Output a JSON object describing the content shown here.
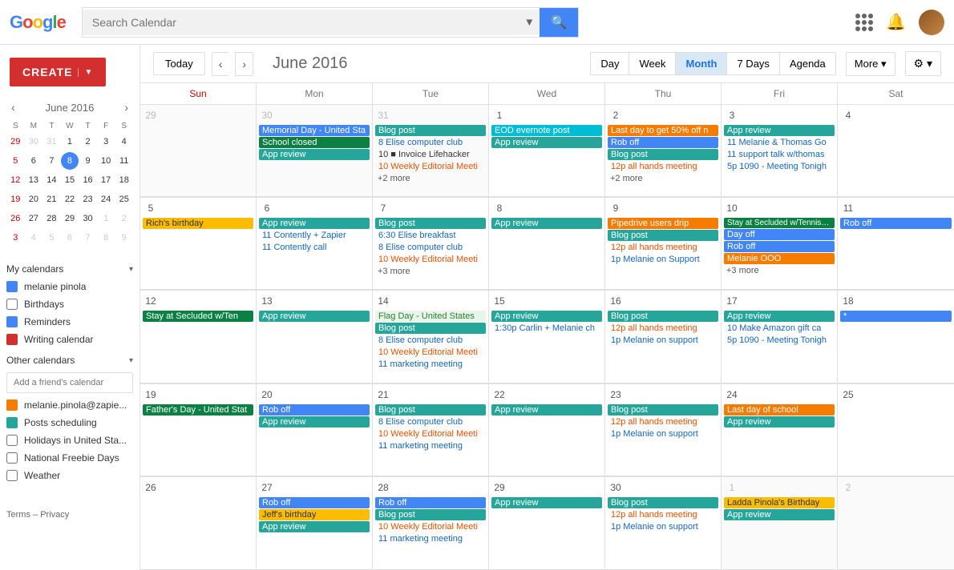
{
  "header": {
    "logo_text": "Google",
    "search_placeholder": "Search Calendar",
    "search_value": ""
  },
  "toolbar": {
    "today_label": "Today",
    "title": "June 2016",
    "views": [
      "Day",
      "Week",
      "Month",
      "7 Days",
      "Agenda"
    ],
    "active_view": "Month",
    "more_label": "More",
    "settings_label": "⚙"
  },
  "sidebar": {
    "create_label": "CREATE",
    "mini_cal": {
      "title": "June 2016",
      "dows": [
        "S",
        "M",
        "T",
        "W",
        "T",
        "F",
        "S"
      ],
      "weeks": [
        [
          {
            "d": "29",
            "other": true,
            "sun": true
          },
          {
            "d": "30",
            "other": true
          },
          {
            "d": "31",
            "other": true
          },
          {
            "d": "1",
            "sun": false
          },
          {
            "d": "2"
          },
          {
            "d": "3"
          },
          {
            "d": "4",
            "sat": true
          }
        ],
        [
          {
            "d": "5",
            "sun": true
          },
          {
            "d": "6"
          },
          {
            "d": "7"
          },
          {
            "d": "8",
            "today": true
          },
          {
            "d": "9"
          },
          {
            "d": "10"
          },
          {
            "d": "11",
            "sat": true
          }
        ],
        [
          {
            "d": "12",
            "sun": true
          },
          {
            "d": "13"
          },
          {
            "d": "14"
          },
          {
            "d": "15"
          },
          {
            "d": "16"
          },
          {
            "d": "17"
          },
          {
            "d": "18",
            "sat": true
          }
        ],
        [
          {
            "d": "19",
            "sun": true
          },
          {
            "d": "20"
          },
          {
            "d": "21"
          },
          {
            "d": "22"
          },
          {
            "d": "23"
          },
          {
            "d": "24"
          },
          {
            "d": "25",
            "sat": true
          }
        ],
        [
          {
            "d": "26",
            "sun": true
          },
          {
            "d": "27"
          },
          {
            "d": "28"
          },
          {
            "d": "29"
          },
          {
            "d": "30"
          },
          {
            "d": "1",
            "other": true
          },
          {
            "d": "2",
            "other": true,
            "sat": true
          }
        ],
        [
          {
            "d": "3",
            "other": true,
            "sun": true
          },
          {
            "d": "4",
            "other": true
          },
          {
            "d": "5",
            "other": true
          },
          {
            "d": "6",
            "other": true
          },
          {
            "d": "7",
            "other": true
          },
          {
            "d": "8",
            "other": true
          },
          {
            "d": "9",
            "other": true,
            "sat": true
          }
        ]
      ]
    },
    "my_calendars": {
      "title": "My calendars",
      "items": [
        {
          "label": "melanie pinola",
          "color": "#4285F4",
          "checked": true
        },
        {
          "label": "Birthdays",
          "color": null,
          "checked": false
        },
        {
          "label": "Reminders",
          "color": "#4285F4",
          "checked": true
        },
        {
          "label": "Writing calendar",
          "color": "#D32F2F",
          "checked": true
        }
      ]
    },
    "other_calendars": {
      "title": "Other calendars",
      "add_placeholder": "Add a friend's calendar",
      "items": [
        {
          "label": "melanie.pinola@zapie...",
          "color": "#F57C00",
          "checked": true
        },
        {
          "label": "Posts scheduling",
          "color": "#26A69A",
          "checked": true
        },
        {
          "label": "Holidays in United Sta...",
          "color": null,
          "checked": false
        },
        {
          "label": "National Freebie Days",
          "color": null,
          "checked": false
        },
        {
          "label": "Weather",
          "color": null,
          "checked": false
        }
      ]
    },
    "footer": {
      "terms": "Terms",
      "privacy": "Privacy"
    }
  },
  "calendar": {
    "day_headers": [
      "Sun",
      "Mon",
      "Tue",
      "Wed",
      "Thu",
      "Fri",
      "Sat"
    ],
    "weeks": [
      {
        "cells": [
          {
            "day": "29",
            "other": true,
            "events": []
          },
          {
            "day": "30",
            "other": true,
            "events": [
              {
                "text": "Memorial Day - United Sta",
                "cls": "allday-blue"
              },
              {
                "text": "School closed",
                "cls": "allday-green"
              },
              {
                "text": "App review",
                "cls": "teal"
              }
            ]
          },
          {
            "day": "31",
            "other": true,
            "events": [
              {
                "text": "Blog post",
                "cls": "teal"
              },
              {
                "text": "8 Elise computer club",
                "cls": "text-blue"
              },
              {
                "text": "10 ■ Invoice Lifehacker",
                "cls": "text-only"
              },
              {
                "text": "10 Weekly Editorial Meeti",
                "cls": "text-orange"
              },
              {
                "text": "+2 more",
                "cls": "more-link"
              }
            ]
          },
          {
            "day": "1",
            "events": [
              {
                "text": "EOD evernote post",
                "cls": "cyan"
              },
              {
                "text": "App review",
                "cls": "teal"
              }
            ]
          },
          {
            "day": "2",
            "events": [
              {
                "text": "Last day to get 50% off n",
                "cls": "orange"
              },
              {
                "text": "Rob off",
                "cls": "allday-blue"
              },
              {
                "text": "Blog post",
                "cls": "teal"
              },
              {
                "text": "12p all hands meeting",
                "cls": "text-orange"
              },
              {
                "text": "+2 more",
                "cls": "more-link"
              }
            ]
          },
          {
            "day": "3",
            "events": [
              {
                "text": "App review",
                "cls": "teal"
              },
              {
                "text": "11 Melanie & Thomas Go",
                "cls": "text-blue"
              },
              {
                "text": "11 support talk w/thomas",
                "cls": "text-blue"
              },
              {
                "text": "5p 1090 - Meeting Tonigh",
                "cls": "text-blue"
              }
            ]
          },
          {
            "day": "4",
            "other": false,
            "events": []
          }
        ]
      },
      {
        "cells": [
          {
            "day": "5",
            "events": [
              {
                "text": "Rich's birthday",
                "cls": "bday"
              }
            ]
          },
          {
            "day": "6",
            "events": [
              {
                "text": "App review",
                "cls": "teal"
              },
              {
                "text": "11 Contently + Zapier",
                "cls": "text-blue"
              },
              {
                "text": "11 Contently call",
                "cls": "text-blue"
              }
            ]
          },
          {
            "day": "7",
            "events": [
              {
                "text": "Blog post",
                "cls": "teal"
              },
              {
                "text": "6:30 Elise breakfast",
                "cls": "text-blue"
              },
              {
                "text": "8 Elise computer club",
                "cls": "text-blue"
              },
              {
                "text": "10 Weekly Editorial Meeti",
                "cls": "text-orange"
              },
              {
                "text": "+3 more",
                "cls": "more-link"
              }
            ]
          },
          {
            "day": "8",
            "events": [
              {
                "text": "App review",
                "cls": "teal"
              }
            ]
          },
          {
            "day": "9",
            "events": [
              {
                "text": "Pipedrive users drip",
                "cls": "orange"
              },
              {
                "text": "Blog post",
                "cls": "teal"
              },
              {
                "text": "12p all hands meeting",
                "cls": "text-orange"
              },
              {
                "text": "1p Melanie on Support",
                "cls": "text-blue"
              }
            ]
          },
          {
            "day": "10",
            "events": [
              {
                "text": "Stay at Secluded w/Tennis/Koi Pond/Hot Tub - Secl",
                "cls": "allday-green"
              },
              {
                "text": "Day off",
                "cls": "allday-blue"
              },
              {
                "text": "Rob off",
                "cls": "allday-blue"
              },
              {
                "text": "Melanie OOO",
                "cls": "orange"
              },
              {
                "text": "+3 more",
                "cls": "more-link"
              }
            ]
          },
          {
            "day": "11",
            "events": [
              {
                "text": "Rob off",
                "cls": "allday-blue"
              }
            ]
          }
        ]
      },
      {
        "cells": [
          {
            "day": "12",
            "events": [
              {
                "text": "Stay at Secluded w/Ten",
                "cls": "allday-green"
              }
            ]
          },
          {
            "day": "13",
            "events": [
              {
                "text": "App review",
                "cls": "teal"
              }
            ]
          },
          {
            "day": "14",
            "events": [
              {
                "text": "Flag Day - United States",
                "cls": "holiday"
              },
              {
                "text": "Blog post",
                "cls": "teal"
              },
              {
                "text": "8 Elise computer club",
                "cls": "text-blue"
              },
              {
                "text": "10 Weekly Editorial Meeti",
                "cls": "text-orange"
              },
              {
                "text": "11 marketing meeting",
                "cls": "text-blue"
              }
            ]
          },
          {
            "day": "15",
            "events": [
              {
                "text": "App review",
                "cls": "teal"
              },
              {
                "text": "1:30p Carlin + Melanie ch",
                "cls": "text-blue"
              }
            ]
          },
          {
            "day": "16",
            "events": [
              {
                "text": "Blog post",
                "cls": "teal"
              },
              {
                "text": "12p all hands meeting",
                "cls": "text-orange"
              },
              {
                "text": "1p Melanie on support",
                "cls": "text-blue"
              }
            ]
          },
          {
            "day": "17",
            "events": [
              {
                "text": "App review",
                "cls": "teal"
              },
              {
                "text": "10 Make Amazon gift ca",
                "cls": "text-blue"
              },
              {
                "text": "5p 1090 - Meeting Tonigh",
                "cls": "text-blue"
              }
            ]
          },
          {
            "day": "18",
            "events": [
              {
                "text": "*",
                "cls": "blue"
              }
            ]
          }
        ]
      },
      {
        "cells": [
          {
            "day": "19",
            "events": [
              {
                "text": "Father's Day - United Stat",
                "cls": "allday-green"
              }
            ]
          },
          {
            "day": "20",
            "events": [
              {
                "text": "Rob off",
                "cls": "allday-blue"
              },
              {
                "text": "App review",
                "cls": "teal"
              }
            ]
          },
          {
            "day": "21",
            "events": [
              {
                "text": "Blog post",
                "cls": "teal"
              },
              {
                "text": "8 Elise computer club",
                "cls": "text-blue"
              },
              {
                "text": "10 Weekly Editorial Meeti",
                "cls": "text-orange"
              },
              {
                "text": "11 marketing meeting",
                "cls": "text-blue"
              }
            ]
          },
          {
            "day": "22",
            "events": [
              {
                "text": "App review",
                "cls": "teal"
              }
            ]
          },
          {
            "day": "23",
            "events": [
              {
                "text": "Blog post",
                "cls": "teal"
              },
              {
                "text": "12p all hands meeting",
                "cls": "text-orange"
              },
              {
                "text": "1p Melanie on support",
                "cls": "text-blue"
              }
            ]
          },
          {
            "day": "24",
            "events": [
              {
                "text": "Last day of school",
                "cls": "orange"
              },
              {
                "text": "App review",
                "cls": "teal"
              }
            ]
          },
          {
            "day": "25",
            "events": []
          }
        ]
      },
      {
        "cells": [
          {
            "day": "26",
            "events": []
          },
          {
            "day": "27",
            "events": [
              {
                "text": "Rob off",
                "cls": "allday-blue"
              },
              {
                "text": "Jeff's birthday",
                "cls": "bday"
              },
              {
                "text": "App review",
                "cls": "teal"
              }
            ]
          },
          {
            "day": "28",
            "events": [
              {
                "text": "Rob off",
                "cls": "allday-blue"
              },
              {
                "text": "Blog post",
                "cls": "teal"
              },
              {
                "text": "10 Weekly Editorial Meeti",
                "cls": "text-orange"
              },
              {
                "text": "11 marketing meeting",
                "cls": "text-blue"
              }
            ]
          },
          {
            "day": "29",
            "events": [
              {
                "text": "App review",
                "cls": "teal"
              }
            ]
          },
          {
            "day": "30",
            "events": [
              {
                "text": "Blog post",
                "cls": "teal"
              },
              {
                "text": "12p all hands meeting",
                "cls": "text-orange"
              },
              {
                "text": "1p Melanie on support",
                "cls": "text-blue"
              }
            ]
          },
          {
            "day": "1",
            "other": true,
            "events": [
              {
                "text": "Ladda Pinola's Birthday",
                "cls": "bday"
              },
              {
                "text": "App review",
                "cls": "teal"
              }
            ]
          },
          {
            "day": "2",
            "other": true,
            "events": []
          }
        ]
      }
    ]
  }
}
